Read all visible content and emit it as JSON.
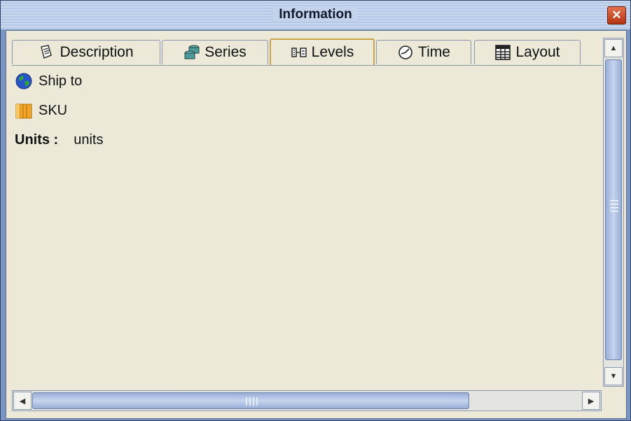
{
  "window": {
    "title": "Information",
    "close_glyph": "✕"
  },
  "tabs": [
    {
      "label": "Description",
      "icon": "description-icon"
    },
    {
      "label": "Series",
      "icon": "series-icon"
    },
    {
      "label": "Levels",
      "icon": "levels-icon",
      "active": true
    },
    {
      "label": "Time",
      "icon": "clock-icon"
    },
    {
      "label": "Layout",
      "icon": "layout-icon"
    }
  ],
  "content": {
    "levels": [
      {
        "label": "Ship to",
        "icon": "globe-icon"
      },
      {
        "label": "SKU",
        "icon": "box-icon"
      }
    ],
    "units_label": "Units :",
    "units_value": "units"
  },
  "scroll": {
    "up_arrow": "▲",
    "down_arrow": "▼",
    "left_arrow": "◀",
    "right_arrow": "▶"
  }
}
